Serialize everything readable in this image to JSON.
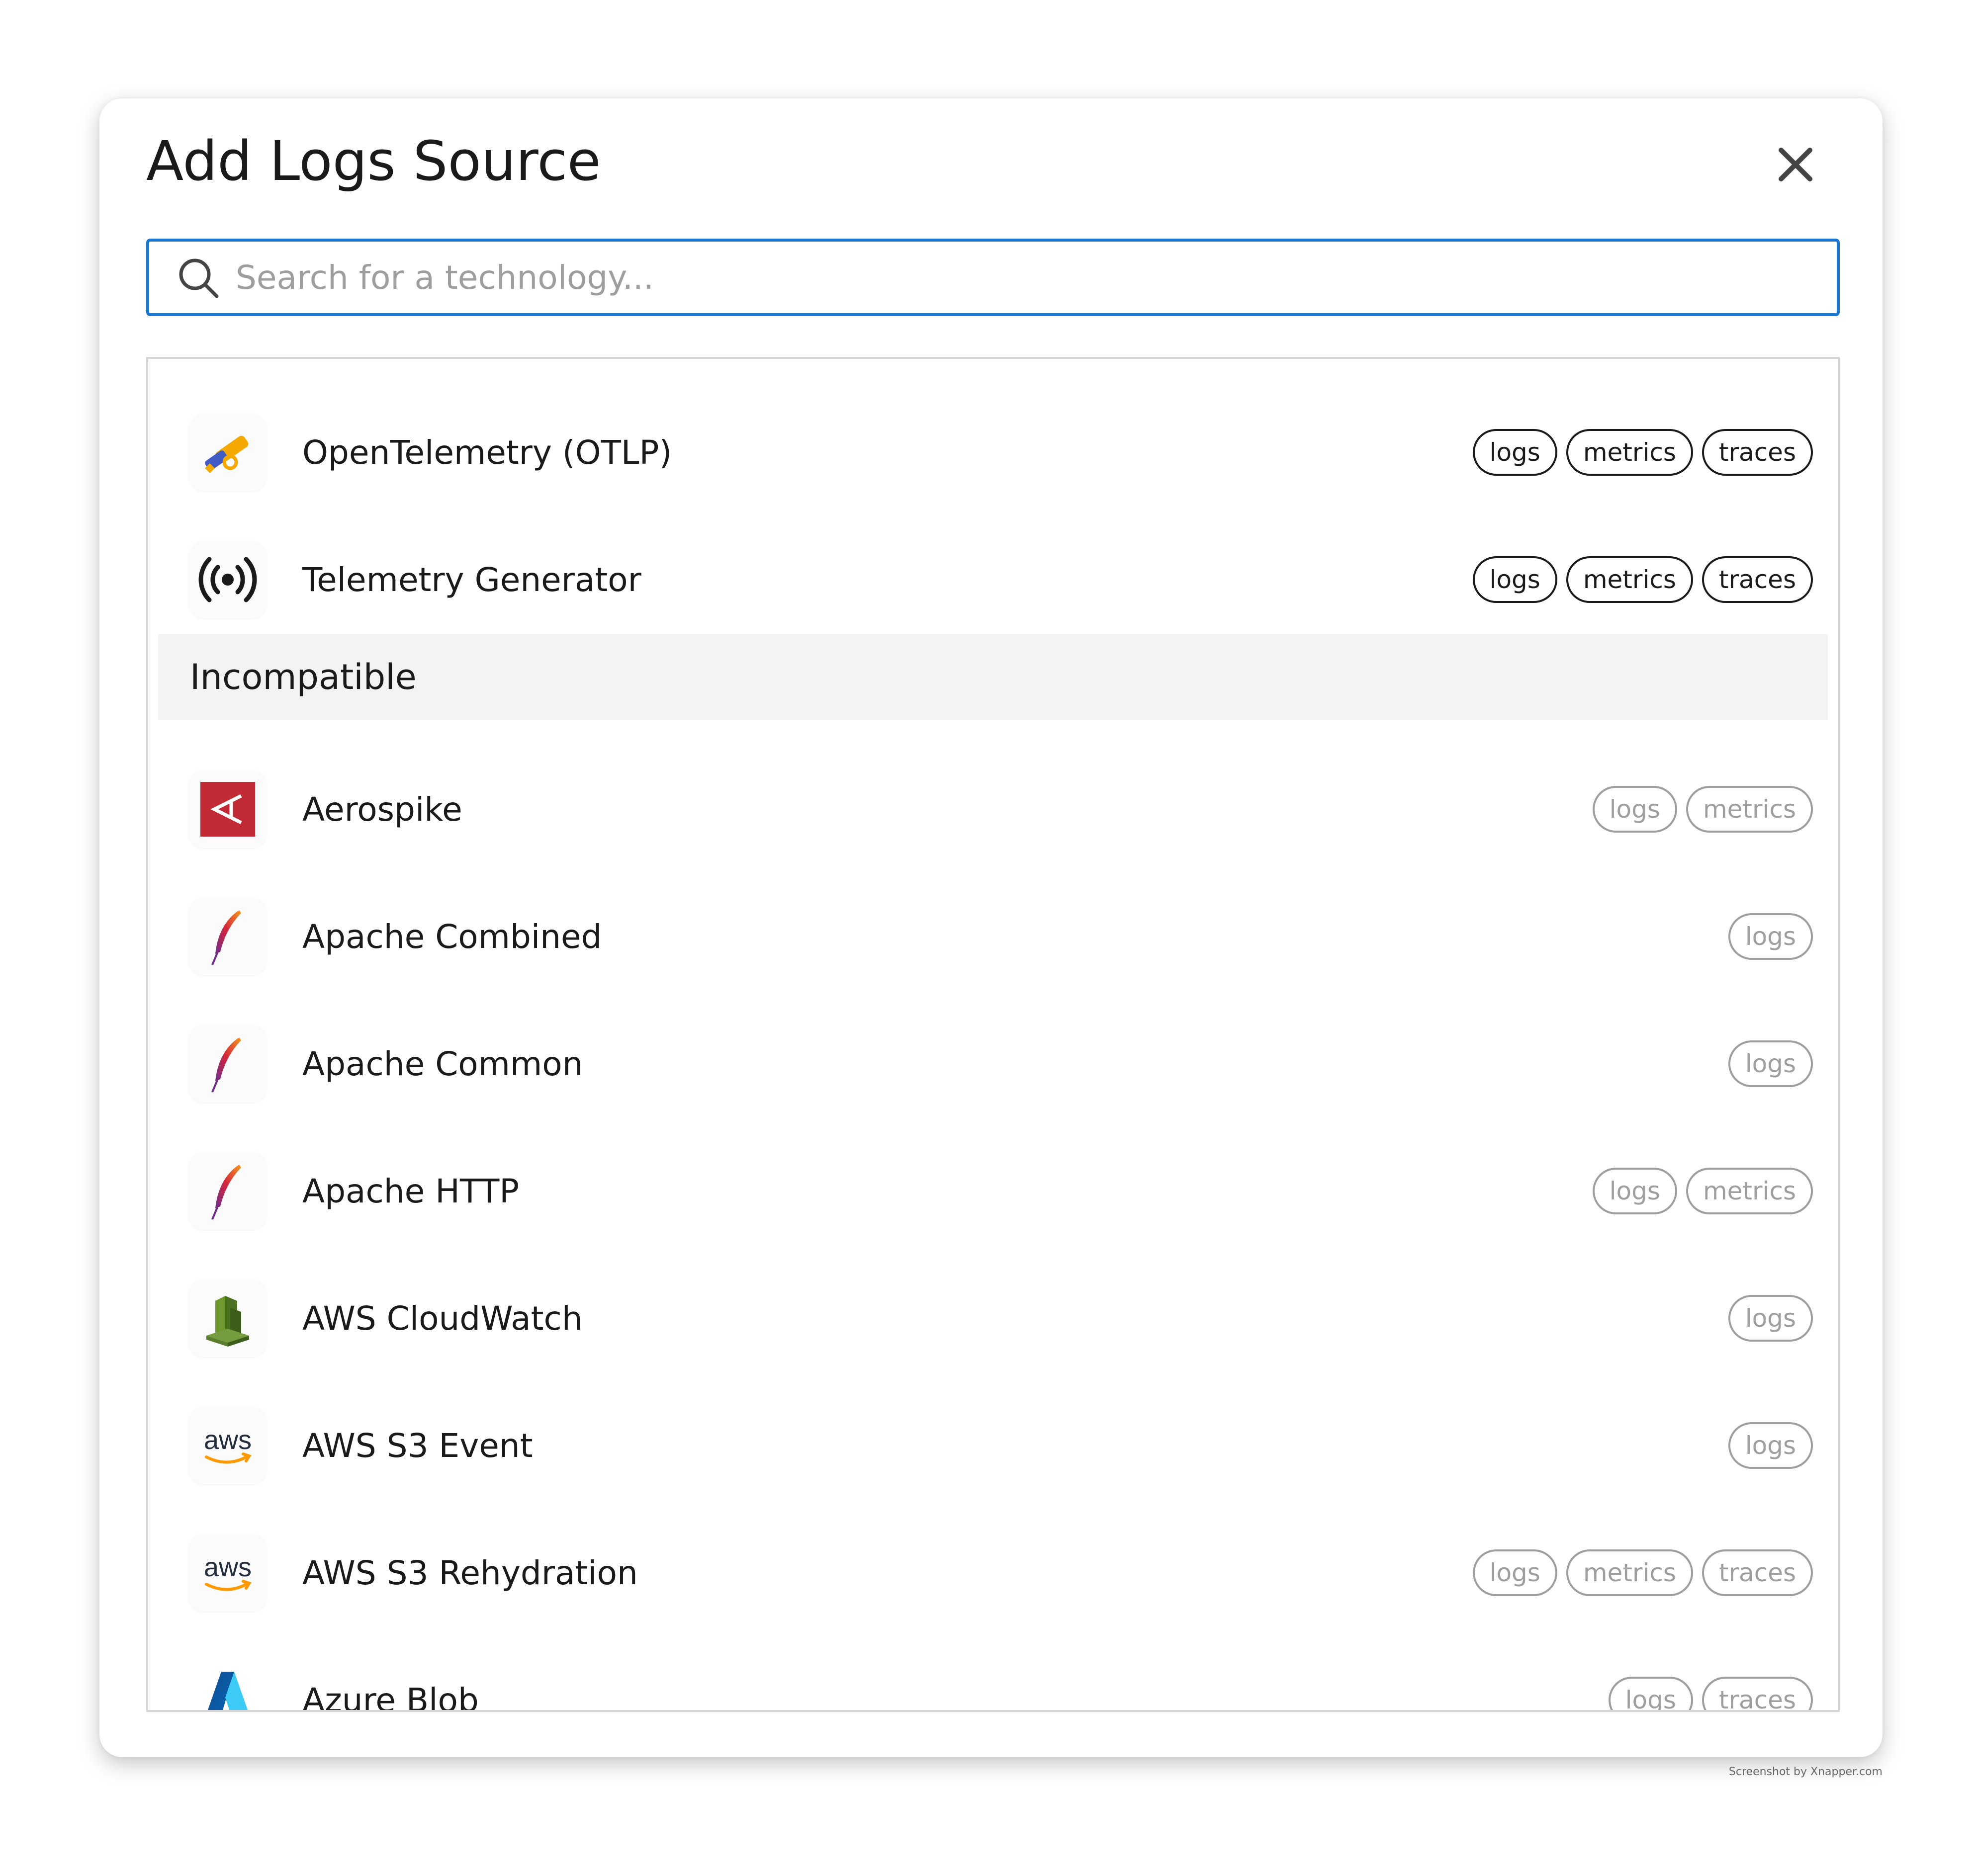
{
  "dialog": {
    "title": "Add Logs Source",
    "close_label": "×"
  },
  "search": {
    "placeholder": "Search for a technology..."
  },
  "compatible": [
    {
      "name": "OpenTelemetry (OTLP)",
      "icon": "opentelemetry-icon",
      "tags": [
        "logs",
        "metrics",
        "traces"
      ]
    },
    {
      "name": "Telemetry Generator",
      "icon": "broadcast-icon",
      "tags": [
        "logs",
        "metrics",
        "traces"
      ]
    }
  ],
  "incompatible_header": "Incompatible",
  "incompatible": [
    {
      "name": "Aerospike",
      "icon": "aerospike-icon",
      "tags": [
        "logs",
        "metrics"
      ]
    },
    {
      "name": "Apache Combined",
      "icon": "apache-feather-icon",
      "tags": [
        "logs"
      ]
    },
    {
      "name": "Apache Common",
      "icon": "apache-feather-icon",
      "tags": [
        "logs"
      ]
    },
    {
      "name": "Apache HTTP",
      "icon": "apache-feather-icon",
      "tags": [
        "logs",
        "metrics"
      ]
    },
    {
      "name": "AWS CloudWatch",
      "icon": "aws-cloudwatch-icon",
      "tags": [
        "logs"
      ]
    },
    {
      "name": "AWS S3 Event",
      "icon": "aws-icon",
      "tags": [
        "logs"
      ]
    },
    {
      "name": "AWS S3 Rehydration",
      "icon": "aws-icon",
      "tags": [
        "logs",
        "metrics",
        "traces"
      ]
    },
    {
      "name": "Azure Blob",
      "icon": "azure-icon",
      "tags": [
        "logs",
        "traces"
      ]
    }
  ],
  "colors": {
    "accent": "#1976d2",
    "incompatible_tag": "#9e9e9e",
    "section_bg": "#f3f3f3"
  },
  "watermark": "Screenshot by Xnapper.com"
}
